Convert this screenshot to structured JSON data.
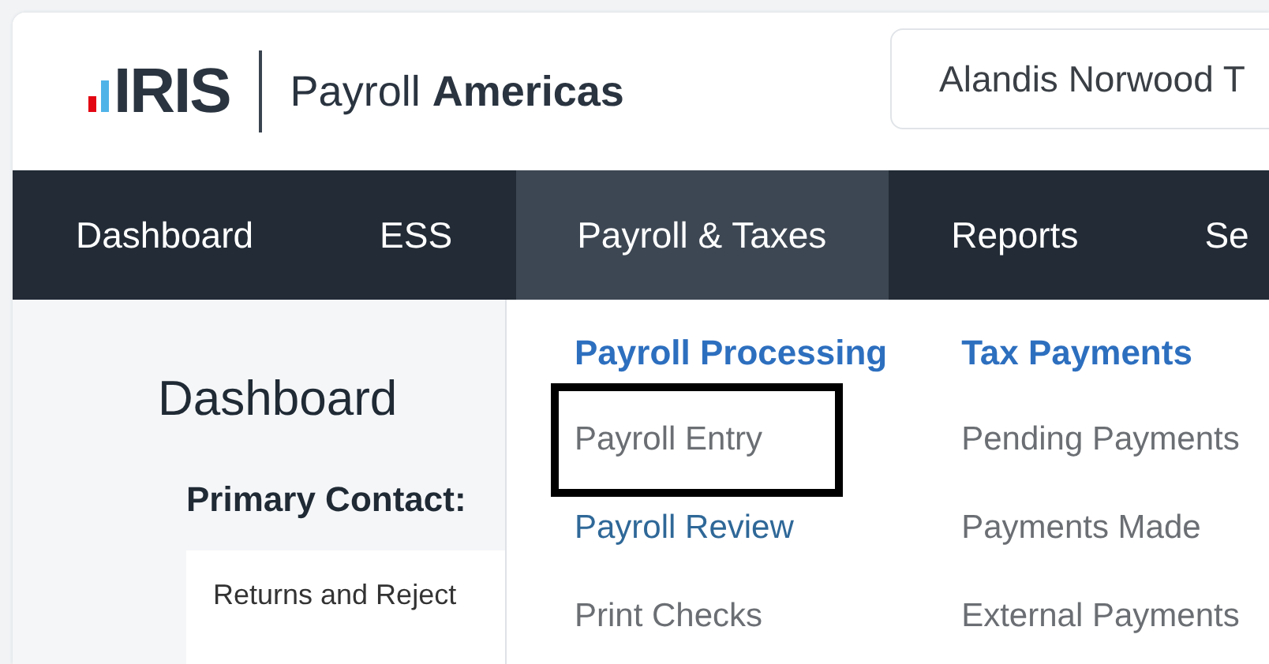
{
  "header": {
    "logo": "IRIS",
    "product": "Payroll **Americas**",
    "company_field": "Alandis Norwood T"
  },
  "nav": [
    {
      "label": "Dashboard",
      "selected": false
    },
    {
      "label": "ESS",
      "selected": false
    },
    {
      "label": "Payroll & Taxes",
      "selected": true
    },
    {
      "label": "Reports",
      "selected": false
    },
    {
      "label": "Se",
      "selected": false
    }
  ],
  "page": {
    "title": "Dashboard",
    "section": "Primary Contact:",
    "card_title": "Returns and Reject"
  },
  "menu": [
    {
      "heading": "Payroll Processing",
      "items": [
        {
          "label": "Payroll Entry",
          "hovered": false,
          "outlined": true
        },
        {
          "label": "Payroll Review",
          "hovered": true,
          "outlined": false
        },
        {
          "label": "Print Checks",
          "hovered": false,
          "outlined": false
        }
      ]
    },
    {
      "heading": "Tax Payments",
      "items": [
        {
          "label": "Pending Payments",
          "hovered": false,
          "outlined": false
        },
        {
          "label": "Payments Made",
          "hovered": false,
          "outlined": false
        },
        {
          "label": "External Payments",
          "hovered": false,
          "outlined": false
        }
      ]
    }
  ]
}
